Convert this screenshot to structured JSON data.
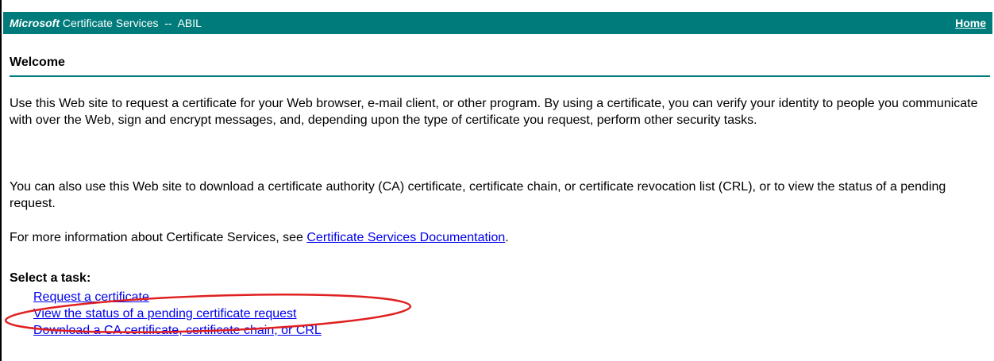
{
  "header": {
    "brand": "Microsoft",
    "title": "Certificate Services  --  ABIL",
    "home_label": "Home",
    "background_color": "#007b7b"
  },
  "welcome": {
    "title": "Welcome"
  },
  "body": {
    "paragraph1": "Use this Web site to request a certificate for your Web browser, e-mail client, or other program. By using a certificate, you can verify your identity to people you communicate with over the Web, sign and encrypt messages, and, depending upon the type of certificate you request, perform other security tasks.",
    "paragraph2": "You can also use this Web site to download a certificate authority (CA) certificate, certificate chain, or certificate revocation list (CRL), or to view the status of a pending request.",
    "paragraph3_prefix": "For more information about Certificate Services, see ",
    "paragraph3_link": "Certificate Services Documentation",
    "paragraph3_suffix": "."
  },
  "tasks": {
    "heading": "Select a task:",
    "items": [
      {
        "label": "Request a certificate"
      },
      {
        "label": "View the status of a pending certificate request"
      },
      {
        "label": "Download a CA certificate, certificate chain, or CRL"
      }
    ]
  },
  "colors": {
    "link": "#0000ee",
    "highlight_ellipse": "#e02020",
    "rule": "#007b7b"
  }
}
